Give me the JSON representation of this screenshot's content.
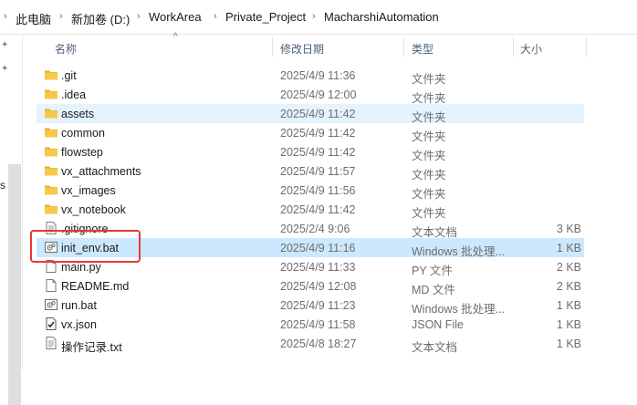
{
  "breadcrumb": {
    "items": [
      "此电脑",
      "新加卷 (D:)",
      "WorkArea",
      "Private_Project",
      "MacharshiAutomation"
    ]
  },
  "left_pane": {
    "cutoff_text": "s"
  },
  "columns": {
    "name": "名称",
    "date": "修改日期",
    "type": "类型",
    "size": "大小"
  },
  "files": [
    {
      "name": ".git",
      "date": "2025/4/9 11:36",
      "type": "文件夹",
      "size": "",
      "icon": "folder-icon"
    },
    {
      "name": ".idea",
      "date": "2025/4/9 12:00",
      "type": "文件夹",
      "size": "",
      "icon": "folder-icon"
    },
    {
      "name": "assets",
      "date": "2025/4/9 11:42",
      "type": "文件夹",
      "size": "",
      "icon": "folder-icon"
    },
    {
      "name": "common",
      "date": "2025/4/9 11:42",
      "type": "文件夹",
      "size": "",
      "icon": "folder-icon"
    },
    {
      "name": "flowstep",
      "date": "2025/4/9 11:42",
      "type": "文件夹",
      "size": "",
      "icon": "folder-icon"
    },
    {
      "name": "vx_attachments",
      "date": "2025/4/9 11:57",
      "type": "文件夹",
      "size": "",
      "icon": "folder-icon"
    },
    {
      "name": "vx_images",
      "date": "2025/4/9 11:56",
      "type": "文件夹",
      "size": "",
      "icon": "folder-icon"
    },
    {
      "name": "vx_notebook",
      "date": "2025/4/9 11:42",
      "type": "文件夹",
      "size": "",
      "icon": "folder-icon"
    },
    {
      "name": ".gitignore",
      "date": "2025/2/4 9:06",
      "type": "文本文档",
      "size": "3 KB",
      "icon": "text-file-icon"
    },
    {
      "name": "init_env.bat",
      "date": "2025/4/9 11:16",
      "type": "Windows 批处理...",
      "size": "1 KB",
      "icon": "batch-file-icon"
    },
    {
      "name": "main.py",
      "date": "2025/4/9 11:33",
      "type": "PY 文件",
      "size": "2 KB",
      "icon": "file-icon"
    },
    {
      "name": "README.md",
      "date": "2025/4/9 12:08",
      "type": "MD 文件",
      "size": "2 KB",
      "icon": "file-icon"
    },
    {
      "name": "run.bat",
      "date": "2025/4/9 11:23",
      "type": "Windows 批处理...",
      "size": "1 KB",
      "icon": "batch-file-icon"
    },
    {
      "name": "vx.json",
      "date": "2025/4/9 11:58",
      "type": "JSON File",
      "size": "1 KB",
      "icon": "json-file-icon"
    },
    {
      "name": "操作记录.txt",
      "date": "2025/4/8 18:27",
      "type": "文本文档",
      "size": "1 KB",
      "icon": "text-file-icon"
    }
  ],
  "state": {
    "hover_index": 2,
    "selected_index": 9,
    "highlighted_index": 9
  },
  "colors": {
    "selected_bg": "#cce8ff",
    "hover_bg": "#e5f3ff",
    "highlight_border": "#e53935",
    "folder": "#f4c34e"
  }
}
